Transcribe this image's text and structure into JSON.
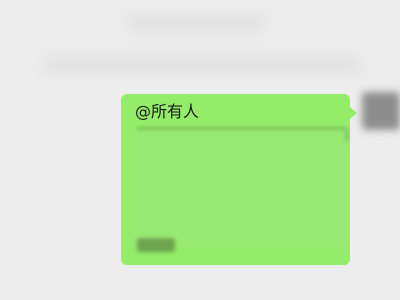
{
  "conversation": {
    "message": {
      "mention_text": "@所有人"
    }
  }
}
